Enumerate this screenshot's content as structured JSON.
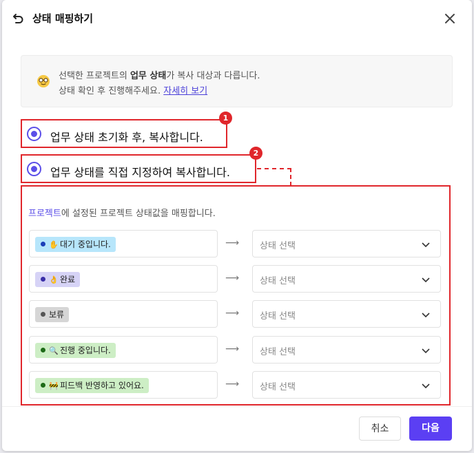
{
  "header": {
    "title": "상태 매핑하기"
  },
  "notice": {
    "line1_pre": "선택한 프로젝트의 ",
    "line1_bold": "업무 상태",
    "line1_post": "가 복사 대상과 다릅니다.",
    "line2_pre": "상태 확인 후 진행해주세요. ",
    "link": "자세히 보기",
    "icon": "nerd-face-icon"
  },
  "options": [
    {
      "label": "업무 상태 초기화 후, 복사합니다.",
      "badge": "1"
    },
    {
      "label": "업무 상태를 직접 지정하여 복사합니다.",
      "badge": "2"
    }
  ],
  "mapping": {
    "desc_accent": "프로젝트",
    "desc_rest": "에 설정된 프로젝트 상태값을 매핑합니다.",
    "arrow": "⟶",
    "rows": [
      {
        "status": "대기 중입니다.",
        "emoji": "✋",
        "dot_color": "#1c3fb8",
        "chip_bg": "#b7e6fb",
        "select_placeholder": "상태 선택"
      },
      {
        "status": "완료",
        "emoji": "👌",
        "dot_color": "#3a2fa8",
        "chip_bg": "#d6d3f6",
        "select_placeholder": "상태 선택"
      },
      {
        "status": "보류",
        "emoji": "",
        "dot_color": "#555555",
        "chip_bg": "#d6d6d6",
        "select_placeholder": "상태 선택"
      },
      {
        "status": "진행 중입니다.",
        "emoji": "🔍",
        "dot_color": "#1e6b18",
        "chip_bg": "#cdeec5",
        "select_placeholder": "상태 선택"
      },
      {
        "status": "피드백 반영하고 있어요.",
        "emoji": "🚧",
        "dot_color": "#1e6b18",
        "chip_bg": "#cdeec5",
        "select_placeholder": "상태 선택"
      }
    ]
  },
  "footer": {
    "cancel": "취소",
    "next": "다음"
  },
  "colors": {
    "accent": "#5b3ff3",
    "highlight": "#e0262b"
  }
}
